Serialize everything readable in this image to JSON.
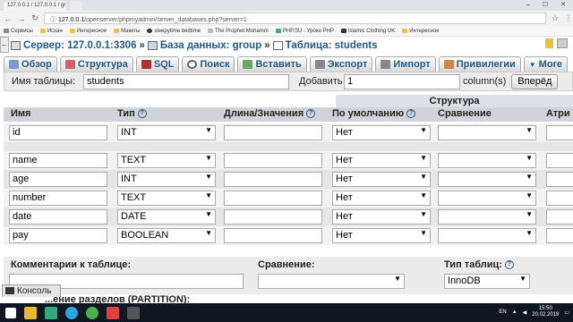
{
  "browser": {
    "tabs": [
      "127.0.0.1 / 127.0.0.1 / gr",
      ""
    ],
    "url_host": "127.0.0.1",
    "url_path": "/openserver/phpmyadmin/server_databases.php?server=1",
    "bookmarks": [
      "Сервисы",
      "Исхан",
      "Интересное",
      "Макеты",
      "sleepytime bedtime",
      "The Prophet Mohamm",
      "PHP.SU - Уроки PHP",
      "Islamic Clothing UK",
      "Интересное"
    ]
  },
  "breadcrumb": {
    "server": "Сервер: 127.0.0.1:3306",
    "database": "База данных: group",
    "table": "Таблица: students",
    "sep": "»"
  },
  "menu": [
    "Обзор",
    "Структура",
    "SQL",
    "Поиск",
    "Вставить",
    "Экспорт",
    "Импорт",
    "Привилегии",
    "More"
  ],
  "tablename": {
    "label": "Имя таблицы:",
    "value": "students",
    "add_label": "Добавить",
    "add_value": "1",
    "columns_label": "column(s)",
    "go_button": "Вперёд"
  },
  "structure": {
    "title": "Структура",
    "columns": [
      "Имя",
      "Тип",
      "Длина/Значения",
      "По умолчанию",
      "Сравнение",
      "Атри"
    ],
    "help": "?",
    "rows": [
      {
        "name": "id",
        "type": "INT",
        "length": "",
        "default": "Нет",
        "collation": ""
      },
      {
        "name": "name",
        "type": "TEXT",
        "length": "",
        "default": "Нет",
        "collation": ""
      },
      {
        "name": "age",
        "type": "INT",
        "length": "",
        "default": "Нет",
        "collation": ""
      },
      {
        "name": "number",
        "type": "TEXT",
        "length": "",
        "default": "Нет",
        "collation": ""
      },
      {
        "name": "date",
        "type": "DATE",
        "length": "",
        "default": "Нет",
        "collation": ""
      },
      {
        "name": "pay",
        "type": "BOOLEAN",
        "length": "",
        "default": "Нет",
        "collation": ""
      }
    ]
  },
  "bottom": {
    "comments_label": "Комментарии к таблице:",
    "collation_label": "Сравнение:",
    "engine_label": "Тип таблиц:",
    "engine_value": "InnoDB",
    "console": "Консоль",
    "partition": "...ение разделов (PARTITION):"
  },
  "tray": {
    "lang": "EN",
    "time": "15:50",
    "date": "20.02.2018"
  },
  "colors": {
    "link": "#235a81",
    "taskbar": "#0f1722"
  }
}
